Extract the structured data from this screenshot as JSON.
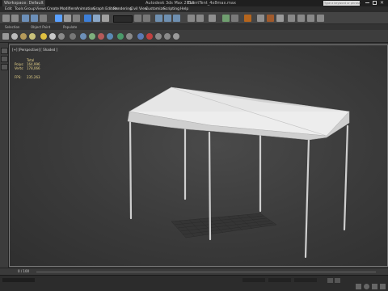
{
  "window": {
    "workspace": "Workspace: Default",
    "title": "Autodesk 3ds Max 2010",
    "filename": "EventTent_4x8max.max",
    "search_placeholder": "Type a keyword or phrase"
  },
  "menu": [
    "Edit",
    "Tools",
    "Group",
    "Views",
    "Create",
    "Modifiers",
    "Animation",
    "Graph Editors",
    "Rendering",
    "Civil View",
    "Customize",
    "Scripting",
    "Help"
  ],
  "ribbon": {
    "selection": "Selection",
    "object_paint": "Object Paint",
    "populate": "Populate"
  },
  "viewport": {
    "label": "[+] [Perspective] [ Shaded ]",
    "stats": {
      "total": "Total",
      "polys_label": "Polys:",
      "polys_value": "164,996",
      "verts_label": "Verts:",
      "verts_value": "178,066",
      "fps_label": "FPS:",
      "fps_value": "235.263"
    }
  },
  "timeline": {
    "frame": "0 / 100"
  },
  "colors": {
    "viewport_bg": "#3a3a3a",
    "accent": "#5aa0ff",
    "stats_text": "#e8d48a"
  },
  "icons": [
    "undo-icon",
    "redo-icon",
    "link-icon",
    "unlink-icon",
    "select-icon",
    "move-icon",
    "rotate-icon",
    "scale-icon",
    "snap-icon",
    "render-icon",
    "teapot-icon",
    "light-icon",
    "camera-icon"
  ]
}
